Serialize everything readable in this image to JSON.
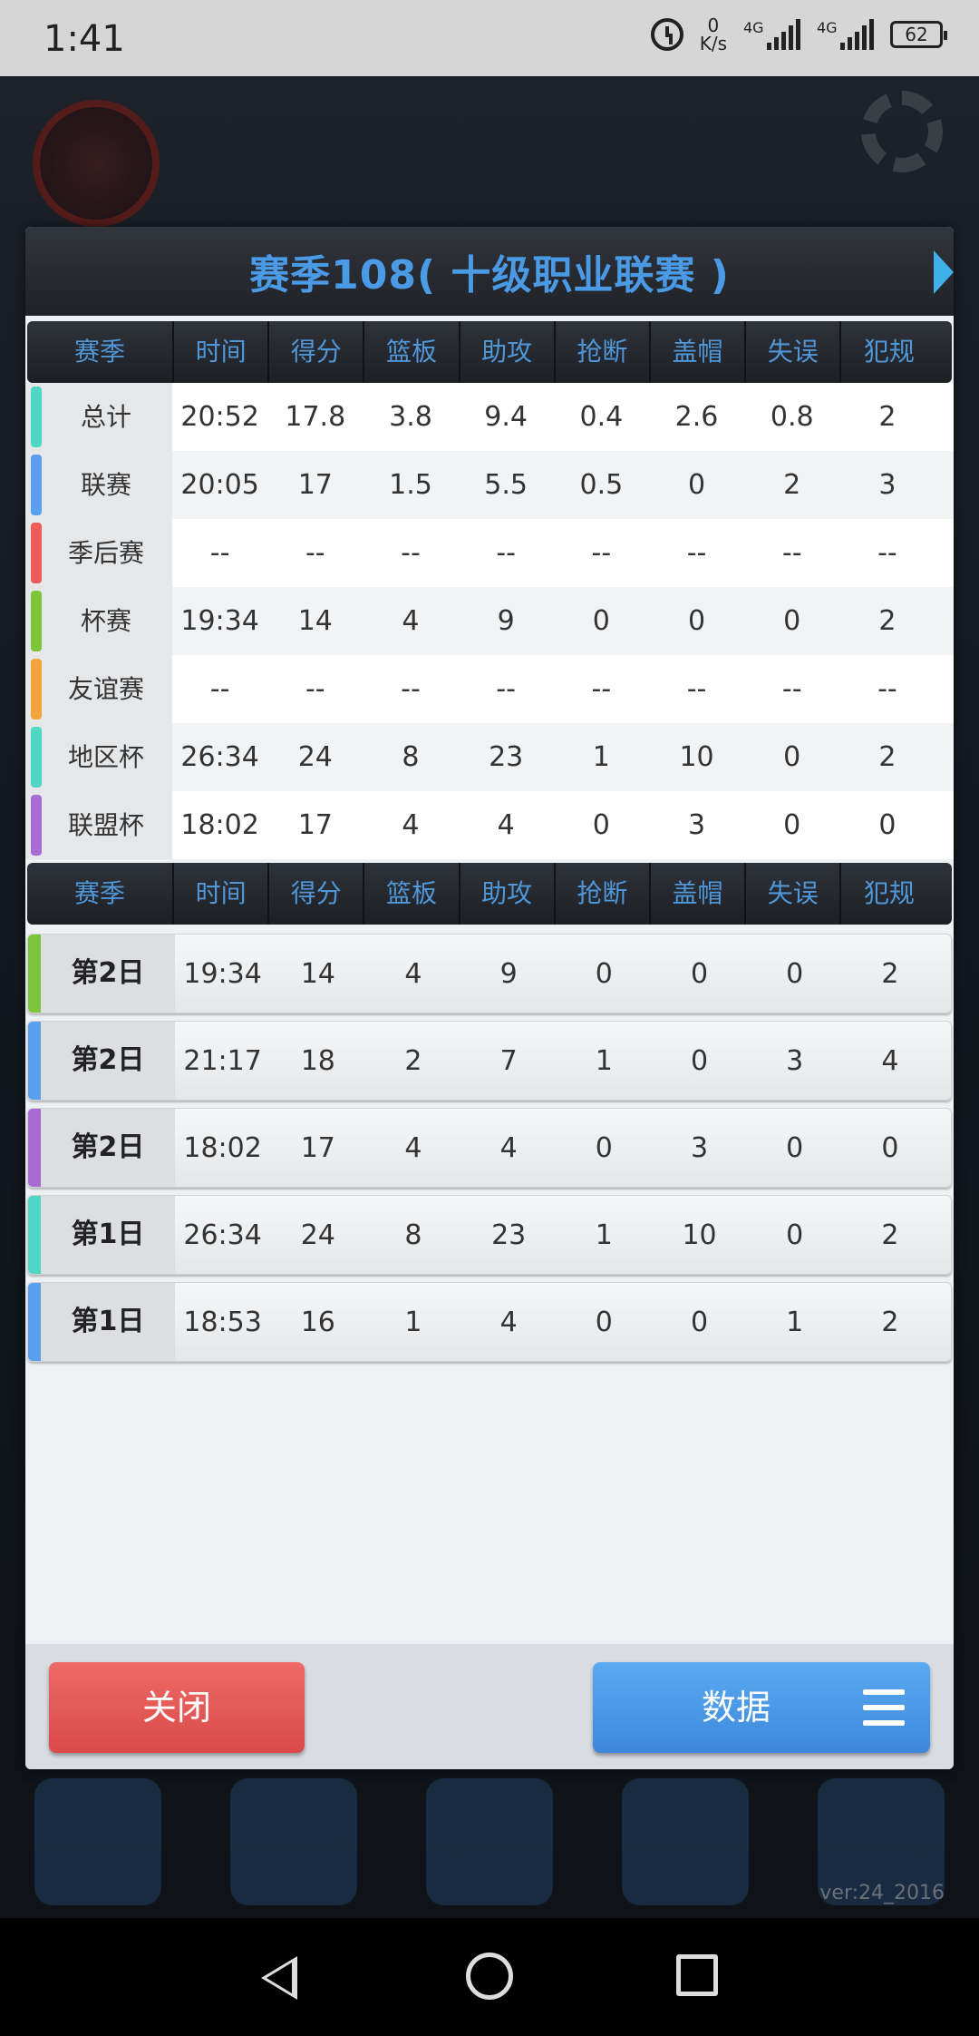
{
  "status_bar": {
    "time": "1:41",
    "net_speed_value": "0",
    "net_speed_unit": "K/s",
    "signal1_label": "4G",
    "signal2_label": "4G",
    "battery": "62"
  },
  "dialog": {
    "title": "赛季108( 十级职业联赛 )",
    "summary_headers": [
      "赛季",
      "时间",
      "得分",
      "篮板",
      "助攻",
      "抢断",
      "盖帽",
      "失误",
      "犯规"
    ],
    "summary_rows": [
      {
        "label": "总计",
        "color": "#4fd6c4",
        "values": [
          "20:52",
          "17.8",
          "3.8",
          "9.4",
          "0.4",
          "2.6",
          "0.8",
          "2"
        ]
      },
      {
        "label": "联赛",
        "color": "#5a9ff0",
        "values": [
          "20:05",
          "17",
          "1.5",
          "5.5",
          "0.5",
          "0",
          "2",
          "3"
        ]
      },
      {
        "label": "季后赛",
        "color": "#ef5a5a",
        "values": [
          "--",
          "--",
          "--",
          "--",
          "--",
          "--",
          "--",
          "--"
        ]
      },
      {
        "label": "杯赛",
        "color": "#7cc43a",
        "values": [
          "19:34",
          "14",
          "4",
          "9",
          "0",
          "0",
          "0",
          "2"
        ]
      },
      {
        "label": "友谊赛",
        "color": "#f4a43c",
        "values": [
          "--",
          "--",
          "--",
          "--",
          "--",
          "--",
          "--",
          "--"
        ]
      },
      {
        "label": "地区杯",
        "color": "#4fd6c4",
        "values": [
          "26:34",
          "24",
          "8",
          "23",
          "1",
          "10",
          "0",
          "2"
        ]
      },
      {
        "label": "联盟杯",
        "color": "#a86bd4",
        "values": [
          "18:02",
          "17",
          "4",
          "4",
          "0",
          "3",
          "0",
          "0"
        ]
      }
    ],
    "game_headers": [
      "赛季",
      "时间",
      "得分",
      "篮板",
      "助攻",
      "抢断",
      "盖帽",
      "失误",
      "犯规"
    ],
    "game_rows": [
      {
        "label": "第2日",
        "color": "#7cc43a",
        "values": [
          "19:34",
          "14",
          "4",
          "9",
          "0",
          "0",
          "0",
          "2"
        ]
      },
      {
        "label": "第2日",
        "color": "#5a9ff0",
        "values": [
          "21:17",
          "18",
          "2",
          "7",
          "1",
          "0",
          "3",
          "4"
        ]
      },
      {
        "label": "第2日",
        "color": "#a86bd4",
        "values": [
          "18:02",
          "17",
          "4",
          "4",
          "0",
          "3",
          "0",
          "0"
        ]
      },
      {
        "label": "第1日",
        "color": "#4fd6c4",
        "values": [
          "26:34",
          "24",
          "8",
          "23",
          "1",
          "10",
          "0",
          "2"
        ]
      },
      {
        "label": "第1日",
        "color": "#5a9ff0",
        "values": [
          "18:53",
          "16",
          "1",
          "4",
          "0",
          "0",
          "1",
          "2"
        ]
      }
    ],
    "close_label": "关闭",
    "data_label": "数据"
  },
  "version": "ver:24_2016"
}
